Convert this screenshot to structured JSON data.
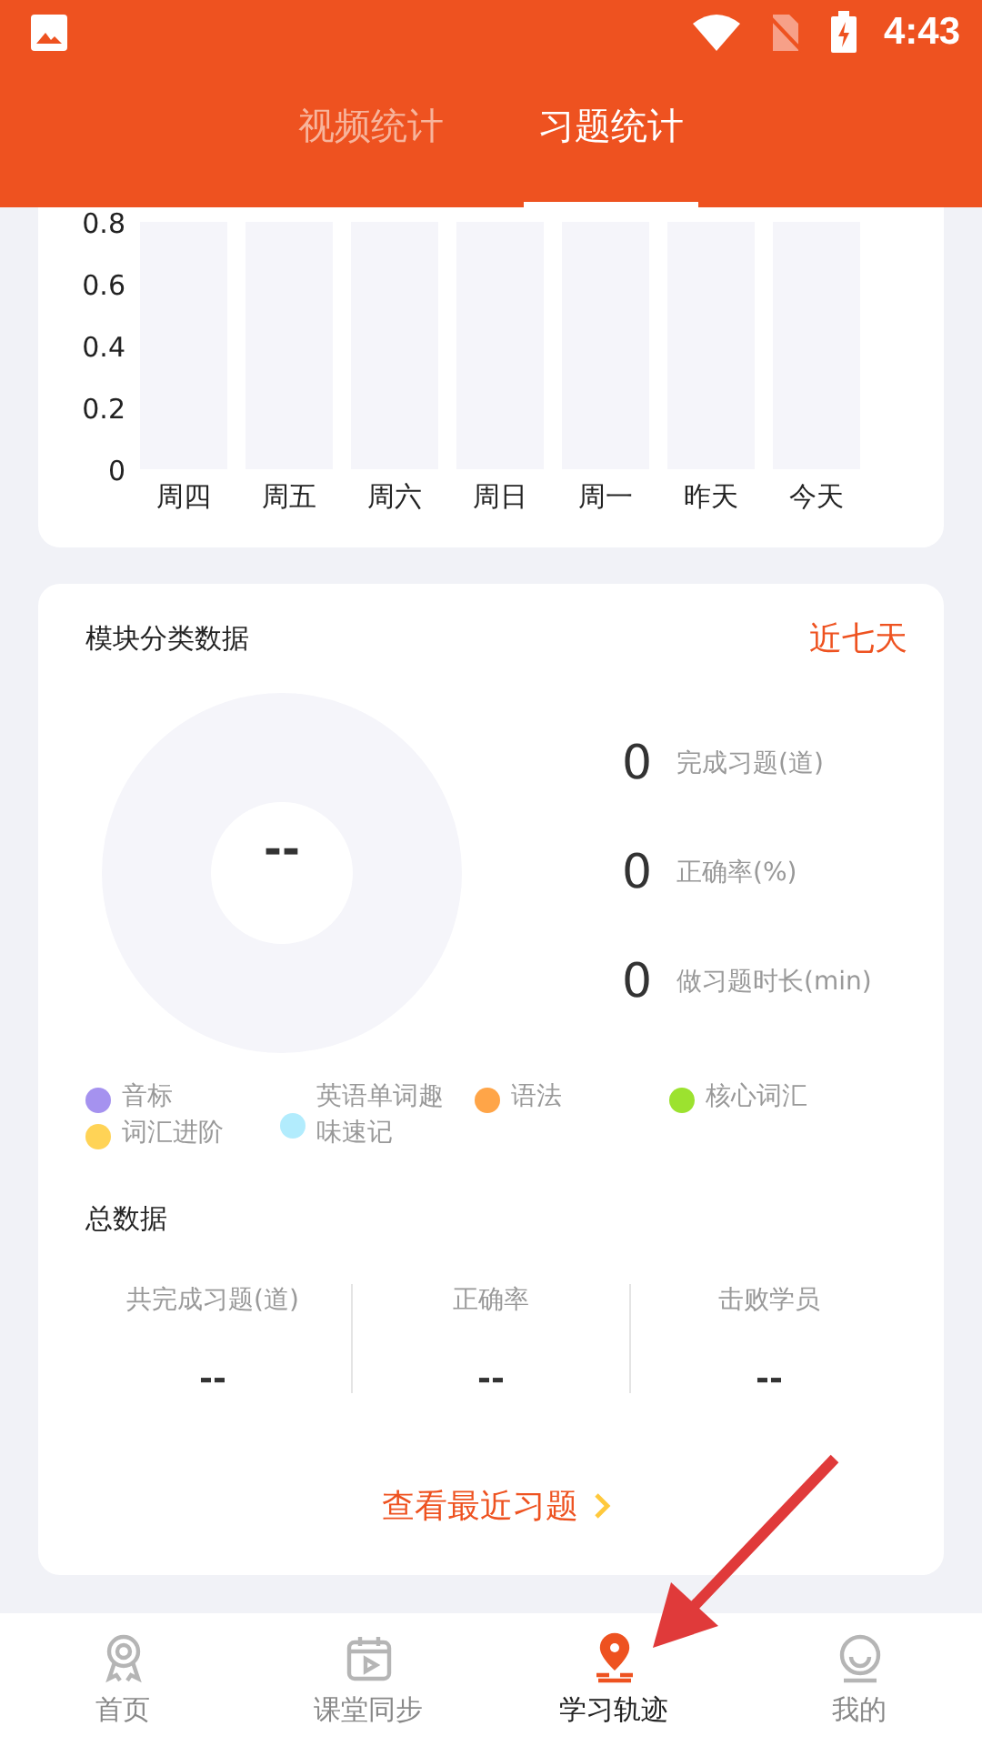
{
  "status_bar": {
    "time": "4:43"
  },
  "tabs": [
    {
      "label": "视频统计",
      "selected": false
    },
    {
      "label": "习题统计",
      "selected": true
    }
  ],
  "weekly_chart": {
    "chart_data": {
      "type": "bar",
      "categories": [
        "周四",
        "周五",
        "周六",
        "周日",
        "周一",
        "昨天",
        "今天"
      ],
      "values": [
        0,
        0,
        0,
        0,
        0,
        0,
        0
      ],
      "ylim": [
        0,
        0.8
      ],
      "yticks": [
        0,
        0.2,
        0.4,
        0.6,
        0.8
      ]
    }
  },
  "module_card": {
    "title": "模块分类数据",
    "range_link": "近七天",
    "donut_center": "--",
    "stats": [
      {
        "value": "0",
        "label": "完成习题(道)"
      },
      {
        "value": "0",
        "label": "正确率(%)"
      },
      {
        "value": "0",
        "label": "做习题时长(min)"
      }
    ],
    "legend": [
      {
        "label": "音标",
        "color": "#a592ef"
      },
      {
        "label": "英语单词趣味速记",
        "color": "#b2ecfd"
      },
      {
        "label": "语法",
        "color": "#ffa548"
      },
      {
        "label": "核心词汇",
        "color": "#9ce22f"
      },
      {
        "label": "词汇进阶",
        "color": "#ffd356"
      }
    ]
  },
  "totals": {
    "title": "总数据",
    "columns": [
      {
        "label": "共完成习题(道)",
        "value": "--"
      },
      {
        "label": "正确率",
        "value": "--"
      },
      {
        "label": "击败学员",
        "value": "--"
      }
    ],
    "link": "查看最近习题"
  },
  "bottom_nav": [
    {
      "label": "首页",
      "kind": "medal",
      "selected": false
    },
    {
      "label": "课堂同步",
      "kind": "calendar",
      "selected": false
    },
    {
      "label": "学习轨迹",
      "kind": "pin",
      "selected": true
    },
    {
      "label": "我的",
      "kind": "face",
      "selected": false
    }
  ]
}
